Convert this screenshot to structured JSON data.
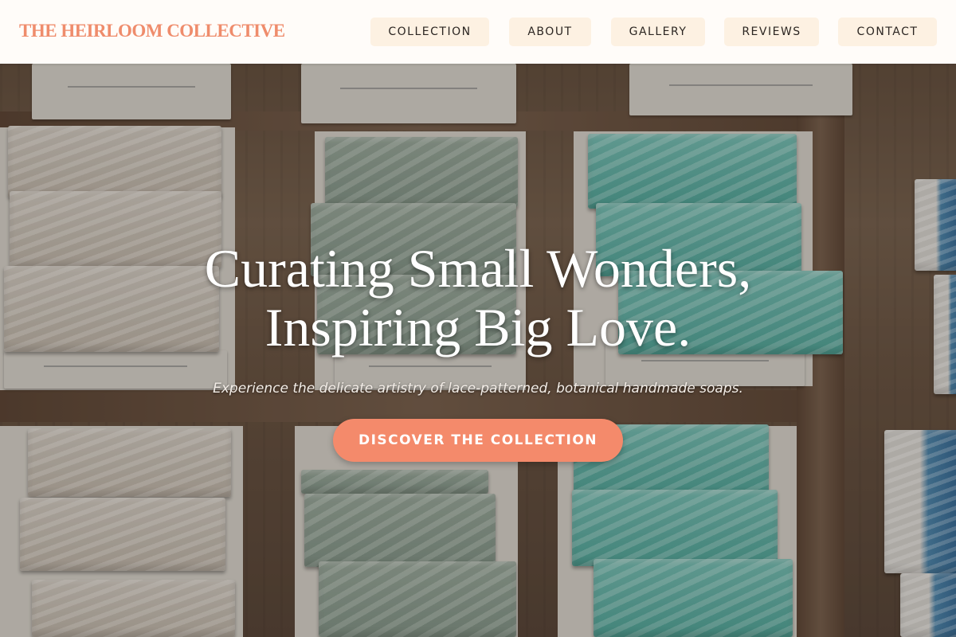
{
  "header": {
    "brand": "THE HEIRLOOM COLLECTIVE",
    "nav": [
      {
        "label": "COLLECTION"
      },
      {
        "label": "ABOUT"
      },
      {
        "label": "GALLERY"
      },
      {
        "label": "REVIEWS"
      },
      {
        "label": "CONTACT"
      }
    ]
  },
  "hero": {
    "title_line1": "Curating Small Wonders,",
    "title_line2": "Inspiring Big Love.",
    "subtitle": "Experience the delicate artistry of lace-patterned, botanical handmade soaps.",
    "cta_label": "DISCOVER THE COLLECTION",
    "background_image": "handmade-soap-bars-photo"
  },
  "colors": {
    "brand": "#ef8c6c",
    "nav_background": "#fdf1e2",
    "cta_background": "#f48a6b",
    "header_background": "#fffcf9"
  }
}
